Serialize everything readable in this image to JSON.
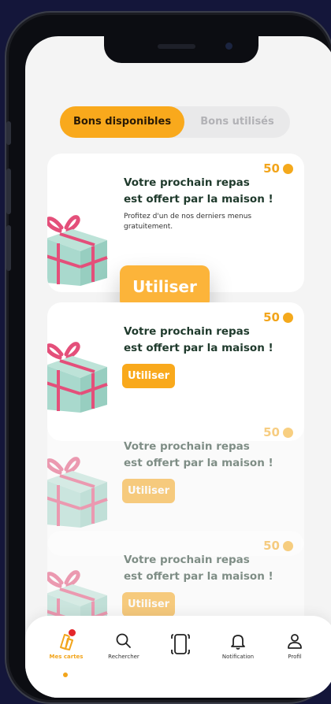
{
  "segment": {
    "available_label": "Bons disponibles",
    "used_label": "Bons utilisés"
  },
  "colors": {
    "accent": "#f9a91c",
    "background": "#f4f4f4",
    "title": "#1f3a2c",
    "dark_bg": "#14163a"
  },
  "cards": [
    {
      "points": "50",
      "title_line1": "Votre prochain repas",
      "title_line2": "est offert par la maison !",
      "description": "Profitez d'un de nos derniers menus gratuitement.",
      "button": "Utiliser"
    },
    {
      "points": "50",
      "title_line1": "Votre prochain repas",
      "title_line2": "est offert par la maison !",
      "button": "Utiliser"
    },
    {
      "points": "50",
      "title_line1": "Votre prochain repas",
      "title_line2": "est offert par la maison !",
      "button": "Utiliser"
    },
    {
      "points": "50",
      "title_line1": "Votre prochain repas",
      "title_line2": "est offert par la maison !",
      "button": "Utiliser"
    }
  ],
  "nav": [
    {
      "label": "Mes cartes",
      "icon": "cards-icon",
      "active": true
    },
    {
      "label": "Rechercher",
      "icon": "search-icon"
    },
    {
      "label": "",
      "icon": "scan-icon"
    },
    {
      "label": "Notification",
      "icon": "bell-icon"
    },
    {
      "label": "Profil",
      "icon": "user-icon"
    }
  ]
}
